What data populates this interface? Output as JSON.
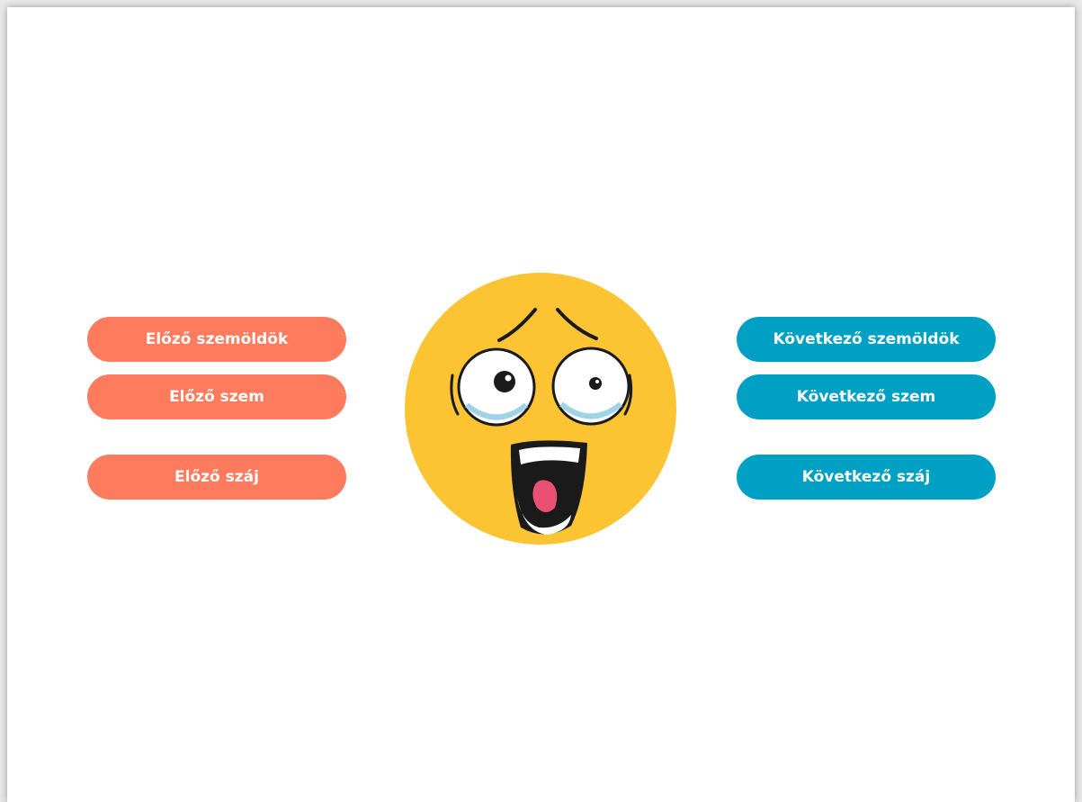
{
  "controls": {
    "prev_eyebrow": "Előző szemöldök",
    "prev_eye": "Előző szem",
    "prev_mouth": "Előző száj",
    "next_eyebrow": "Következő szemöldök",
    "next_eye": "Következő szem",
    "next_mouth": "Következő száj"
  },
  "face": {
    "icon": "scared-face-icon",
    "skin_color": "#fcc433"
  },
  "colors": {
    "prev_button": "#fe7c5d",
    "next_button": "#00a0c5"
  }
}
